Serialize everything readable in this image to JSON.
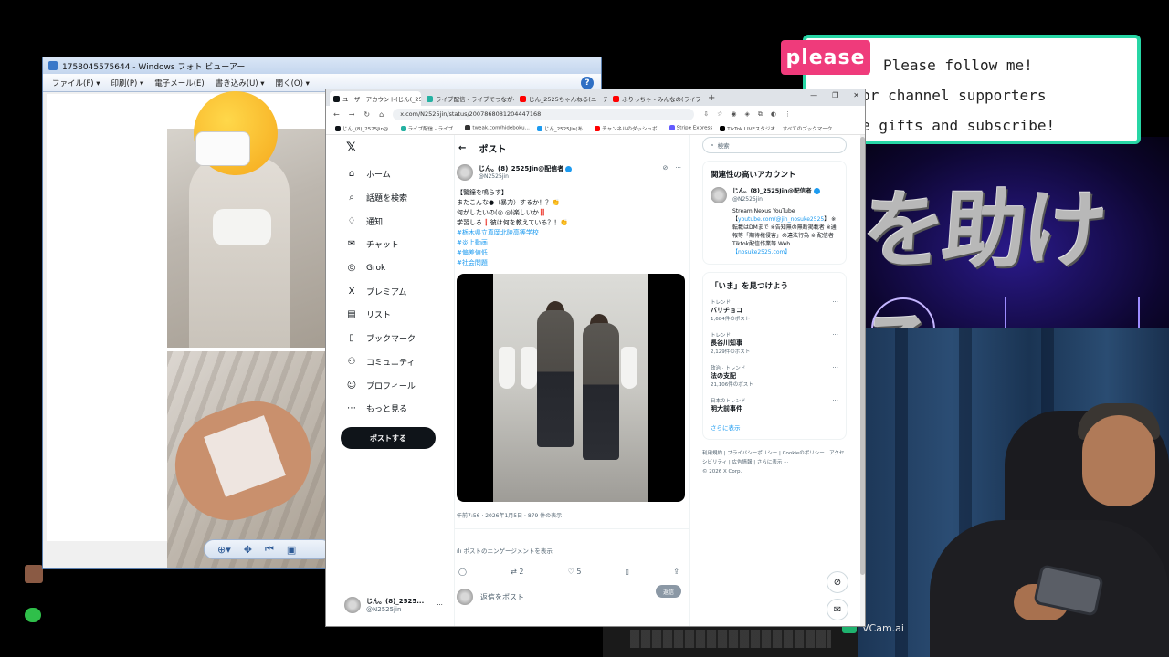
{
  "follow_banner": {
    "tag": "please",
    "line1": "Please follow me!",
    "line2": "ing for channel supporters",
    "line3": "e give gifts and subscribe!"
  },
  "stream_banner_text": "を助ける",
  "vcam_label": "VCam.ai",
  "photo_viewer": {
    "title": "1758045575644 - Windows フォト ビューアー",
    "menu": [
      "ファイル(F) ▾",
      "印刷(P) ▾",
      "電子メール(E)",
      "書き込み(U) ▾",
      "開く(O) ▾"
    ],
    "help": "?"
  },
  "browser": {
    "tabs": [
      {
        "label": "ユーザーアカウント(じん(_25...",
        "color": "#0f1419",
        "active": true
      },
      {
        "label": "ライブ配信 - ライブでつながる",
        "color": "#25b1a2",
        "active": false
      },
      {
        "label": "じん_2525ちゃんねる(ユーチューブ)",
        "color": "#ff0000",
        "active": false
      },
      {
        "label": "ふりっちゃ - みんなの(ライブ)",
        "color": "#ff0000",
        "active": false
      }
    ],
    "window_controls": [
      "—",
      "❐",
      "✕"
    ],
    "url": "x.com/N2525jin/status/2007868081204447168",
    "bookmarks": [
      "じん_(8)_2525Jin@...",
      "ライブ配信 - ライブ...",
      "tweak.com/hideboku...",
      "じん_2525Jin(あ...",
      "チャンネルのダッシュボ...",
      "Stripe Express",
      "TikTok LIVEスタジオ"
    ],
    "bookmarks_more": "すべてのブックマーク"
  },
  "x": {
    "nav": [
      {
        "icon": "⌂",
        "label": "ホーム",
        "name": "home"
      },
      {
        "icon": "⌕",
        "label": "話題を検索",
        "name": "explore"
      },
      {
        "icon": "♢",
        "label": "通知",
        "name": "notifications"
      },
      {
        "icon": "✉",
        "label": "チャット",
        "name": "chat"
      },
      {
        "icon": "◎",
        "label": "Grok",
        "name": "grok"
      },
      {
        "icon": "X",
        "label": "プレミアム",
        "name": "premium"
      },
      {
        "icon": "▤",
        "label": "リスト",
        "name": "lists"
      },
      {
        "icon": "▯",
        "label": "ブックマーク",
        "name": "bookmarks"
      },
      {
        "icon": "⚇",
        "label": "コミュニティ",
        "name": "communities"
      },
      {
        "icon": "☺",
        "label": "プロフィール",
        "name": "profile"
      },
      {
        "icon": "⋯",
        "label": "もっと見る",
        "name": "more"
      }
    ],
    "post_button": "ポストする",
    "current_user": {
      "name": "じん。(8)_2525...",
      "handle": "@N2525jin"
    },
    "header": {
      "back": "←",
      "title": "ポスト"
    },
    "post": {
      "author": "じん。(8)_2525Jin@配信者",
      "handle": "@N2525jin",
      "lines": [
        "【警鐘を鳴らす】",
        "またこんな●（暴力）するか！？👏",
        "何がしたいの(◎ ◎)楽しいか‼️",
        "学習しろ❗️彼は何を教えている？！👏"
      ],
      "hashtags": [
        "#栃木県立真岡北陵高等学校",
        "#炎上動画",
        "#偏差値低",
        "#社会問題"
      ],
      "meta": "午前7:56 · 2026年1月5日 · 879 件の表示",
      "engagement": "ポストのエンゲージメントを表示",
      "actions": {
        "reply": "",
        "repost": "2",
        "like": "5",
        "bookmark": "",
        "share": ""
      },
      "reply_placeholder": "返信をポスト",
      "reply_button": "返信"
    },
    "search_placeholder": "検索",
    "related": {
      "title": "関連性の高いアカウント",
      "name": "じん。(8)_2525Jin@配信者",
      "handle": "@N2525jin",
      "bio": "Stream Nexus YouTube 【",
      "bio_link": "youtube.com/@jin_nosuke2525",
      "bio_rest": "】 ※ 転載はDMまで ※告知無の無断掲載者 ※通報等「期待権侵害」の違法行為 ※ 配信者 Tiktok配信作業等 Web",
      "bio_link2": "【nosuke2525.com】"
    },
    "trends": {
      "title": "「いま」を見つけよう",
      "items": [
        {
          "cat": "トレンド",
          "name": "バリチョコ",
          "count": "1,684件のポスト"
        },
        {
          "cat": "トレンド",
          "name": "長谷川知事",
          "count": "2,129件のポスト"
        },
        {
          "cat": "政治 · トレンド",
          "name": "法の支配",
          "count": "21,106件のポスト"
        },
        {
          "cat": "日本のトレンド",
          "name": "明大前事件",
          "count": ""
        }
      ],
      "show_more": "さらに表示"
    },
    "footer": [
      "利用規約",
      "プライバシーポリシー",
      "Cookieのポリシー",
      "アクセシビリティ",
      "広告情報",
      "さらに表示 ···",
      "© 2026 X Corp."
    ]
  }
}
